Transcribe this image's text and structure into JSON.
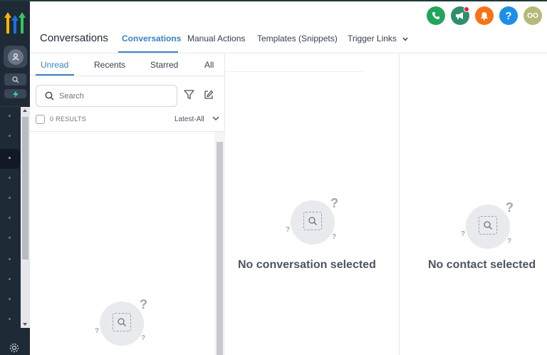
{
  "header": {
    "title": "Conversations",
    "tabs": [
      {
        "label": "Conversations",
        "active": true
      },
      {
        "label": "Manual Actions"
      },
      {
        "label": "Templates (Snippets)"
      },
      {
        "label": "Trigger Links"
      }
    ],
    "avatar_initials": "OO",
    "help_label": "?"
  },
  "icons": {
    "phone": "phone-icon",
    "megaphone": "megaphone-icon",
    "bell": "bell-icon",
    "help": "help-icon",
    "settings": "gear-icon"
  },
  "colors": {
    "phone": "#22a55b",
    "megaphone": "#2f8f6b",
    "bell": "#f97316",
    "help": "#1d8fe8",
    "avatar": "#b7b97a",
    "accent": "#3b82c4",
    "rail": "#1f2a37"
  },
  "list": {
    "subtabs": [
      "Unread",
      "Recents",
      "Starred",
      "All"
    ],
    "active_subtab": "Unread",
    "search_placeholder": "Search",
    "results": "0 RESULTS",
    "sort": "Latest-All"
  },
  "middle": {
    "empty_text": "No conversation selected"
  },
  "right": {
    "empty_text": "No contact selected"
  }
}
